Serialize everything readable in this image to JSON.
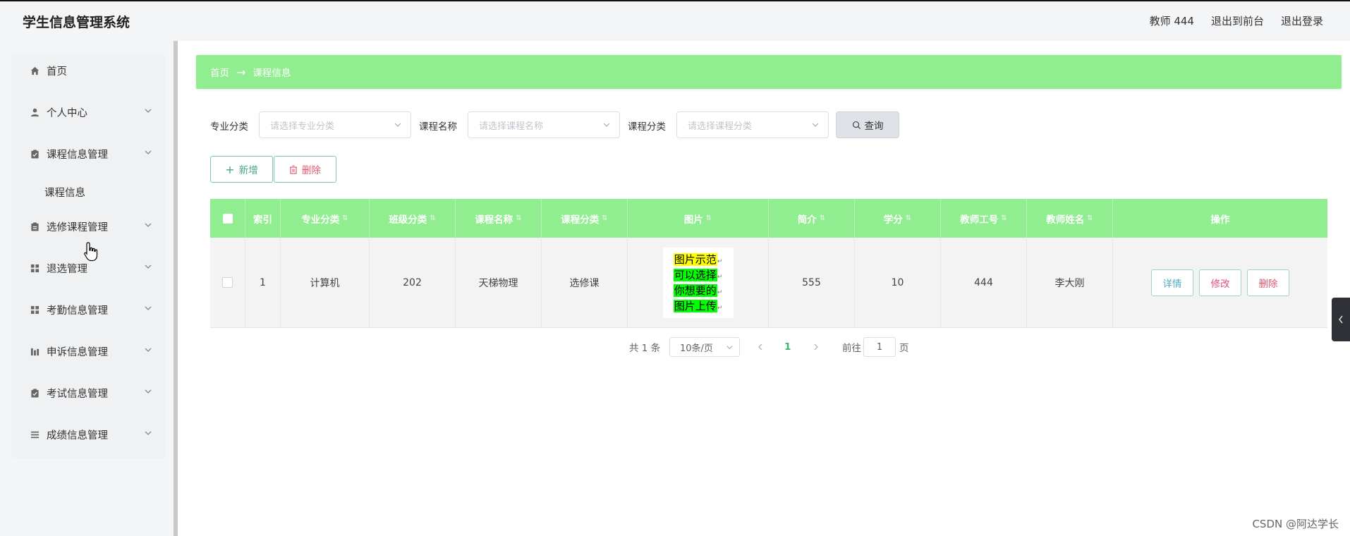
{
  "app": {
    "title": "学生信息管理系统"
  },
  "header": {
    "user_label": "教师 444",
    "front_link": "退出到前台",
    "logout_link": "退出登录"
  },
  "sidebar": {
    "items": [
      {
        "label": "首页",
        "icon": "home-icon"
      },
      {
        "label": "个人中心",
        "icon": "user-icon"
      },
      {
        "label": "课程信息管理",
        "icon": "clipboard-icon"
      },
      {
        "label": "课程信息",
        "icon": ""
      },
      {
        "label": "选修课程管理",
        "icon": "clipboard-icon"
      },
      {
        "label": "退选管理",
        "icon": "grid-icon"
      },
      {
        "label": "考勤信息管理",
        "icon": "grid-icon"
      },
      {
        "label": "申诉信息管理",
        "icon": "chart-icon"
      },
      {
        "label": "考试信息管理",
        "icon": "clipboard-icon"
      },
      {
        "label": "成绩信息管理",
        "icon": "list-icon"
      }
    ]
  },
  "breadcrumb": {
    "home": "首页",
    "separator": "→",
    "current": "课程信息"
  },
  "filters": {
    "major_label": "专业分类",
    "major_placeholder": "请选择专业分类",
    "course_label": "课程名称",
    "course_placeholder": "请选择课程名称",
    "type_label": "课程分类",
    "type_placeholder": "请选择课程分类",
    "query_label": "查询"
  },
  "toolbar": {
    "add_label": "新增",
    "delete_label": "删除"
  },
  "table": {
    "headers": [
      "索引",
      "专业分类",
      "班级分类",
      "课程名称",
      "课程分类",
      "图片",
      "简介",
      "学分",
      "教师工号",
      "教师姓名",
      "操作"
    ],
    "rows": [
      {
        "index": "1",
        "major": "计算机",
        "class": "202",
        "course": "天梯物理",
        "type": "选修课",
        "image_lines": [
          "图片示范",
          "可以选择",
          "你想要的",
          "图片上传"
        ],
        "intro": "555",
        "credit": "10",
        "teacher_id": "444",
        "teacher_name": "李大刚",
        "actions": {
          "detail": "详情",
          "edit": "修改",
          "delete": "删除"
        }
      }
    ]
  },
  "pagination": {
    "total": "共 1 条",
    "page_size": "10条/页",
    "current_page": "1",
    "goto_label": "前往",
    "goto_value": "1",
    "page_suffix": "页"
  },
  "watermark": "CSDN @阿达学长",
  "colors": {
    "accent": "#90ee90",
    "sidebar_bg": "#f0f1f3",
    "header_bg": "#f4f5f7"
  }
}
